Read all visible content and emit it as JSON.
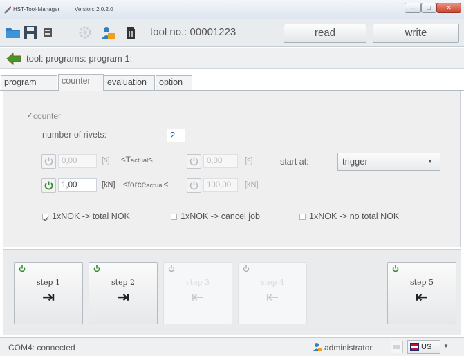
{
  "window": {
    "app_name": "HST-Tool-Manager",
    "version": "Version: 2.0.2.0",
    "minimize": "–",
    "maximize": "□",
    "close": "✕"
  },
  "toolbar": {
    "tool_no": "tool no.: 00001223",
    "read_label": "read",
    "write_label": "write",
    "icons": [
      "folder-icon",
      "save-icon",
      "list-icon",
      "gear-icon",
      "users-icon",
      "trash-icon"
    ]
  },
  "breadcrumb": {
    "text": "tool: programs: program 1:"
  },
  "tabs": [
    {
      "label": "program",
      "active": false
    },
    {
      "label": "counter",
      "active": true
    },
    {
      "label": "evaluation",
      "active": false
    },
    {
      "label": "option",
      "active": false
    }
  ],
  "counter": {
    "section_label": "counter",
    "section_checked": true,
    "rivets_label": "number of rivets:",
    "rivets_value": "2",
    "t_min_value": "0,00",
    "t_unit": "[s]",
    "t_label_le": "≤T",
    "t_label_sub": "actual",
    "t_label_le2": "≤",
    "t_max_value": "0,00",
    "start_label": "start at:",
    "start_value": "trigger",
    "f_min_value": "1,00",
    "f_unit": "[kN]",
    "f_label_le": "≤force",
    "f_label_sub": "actual",
    "f_label_le2": "≤",
    "f_max_value": "100,00",
    "options": [
      {
        "label": "1xNOK -> total NOK",
        "checked": true
      },
      {
        "label": "1xNOK -> cancel job",
        "checked": false
      },
      {
        "label": "1xNOK -> no total NOK",
        "checked": false
      }
    ]
  },
  "steps": [
    {
      "label": "step 1",
      "arrow": "→",
      "enabled": true
    },
    {
      "label": "step 2",
      "arrow": "→",
      "enabled": true
    },
    {
      "label": "step 3",
      "arrow": "←",
      "enabled": false
    },
    {
      "label": "step 4",
      "arrow": "←",
      "enabled": false
    },
    {
      "label": "step 5",
      "arrow": "←",
      "enabled": true
    }
  ],
  "status": {
    "connection": "COM4: connected",
    "user": "administrator",
    "language": "US"
  },
  "colors": {
    "accent_green": "#2e8b2e",
    "rivet_highlight": "#1a5fb4"
  }
}
